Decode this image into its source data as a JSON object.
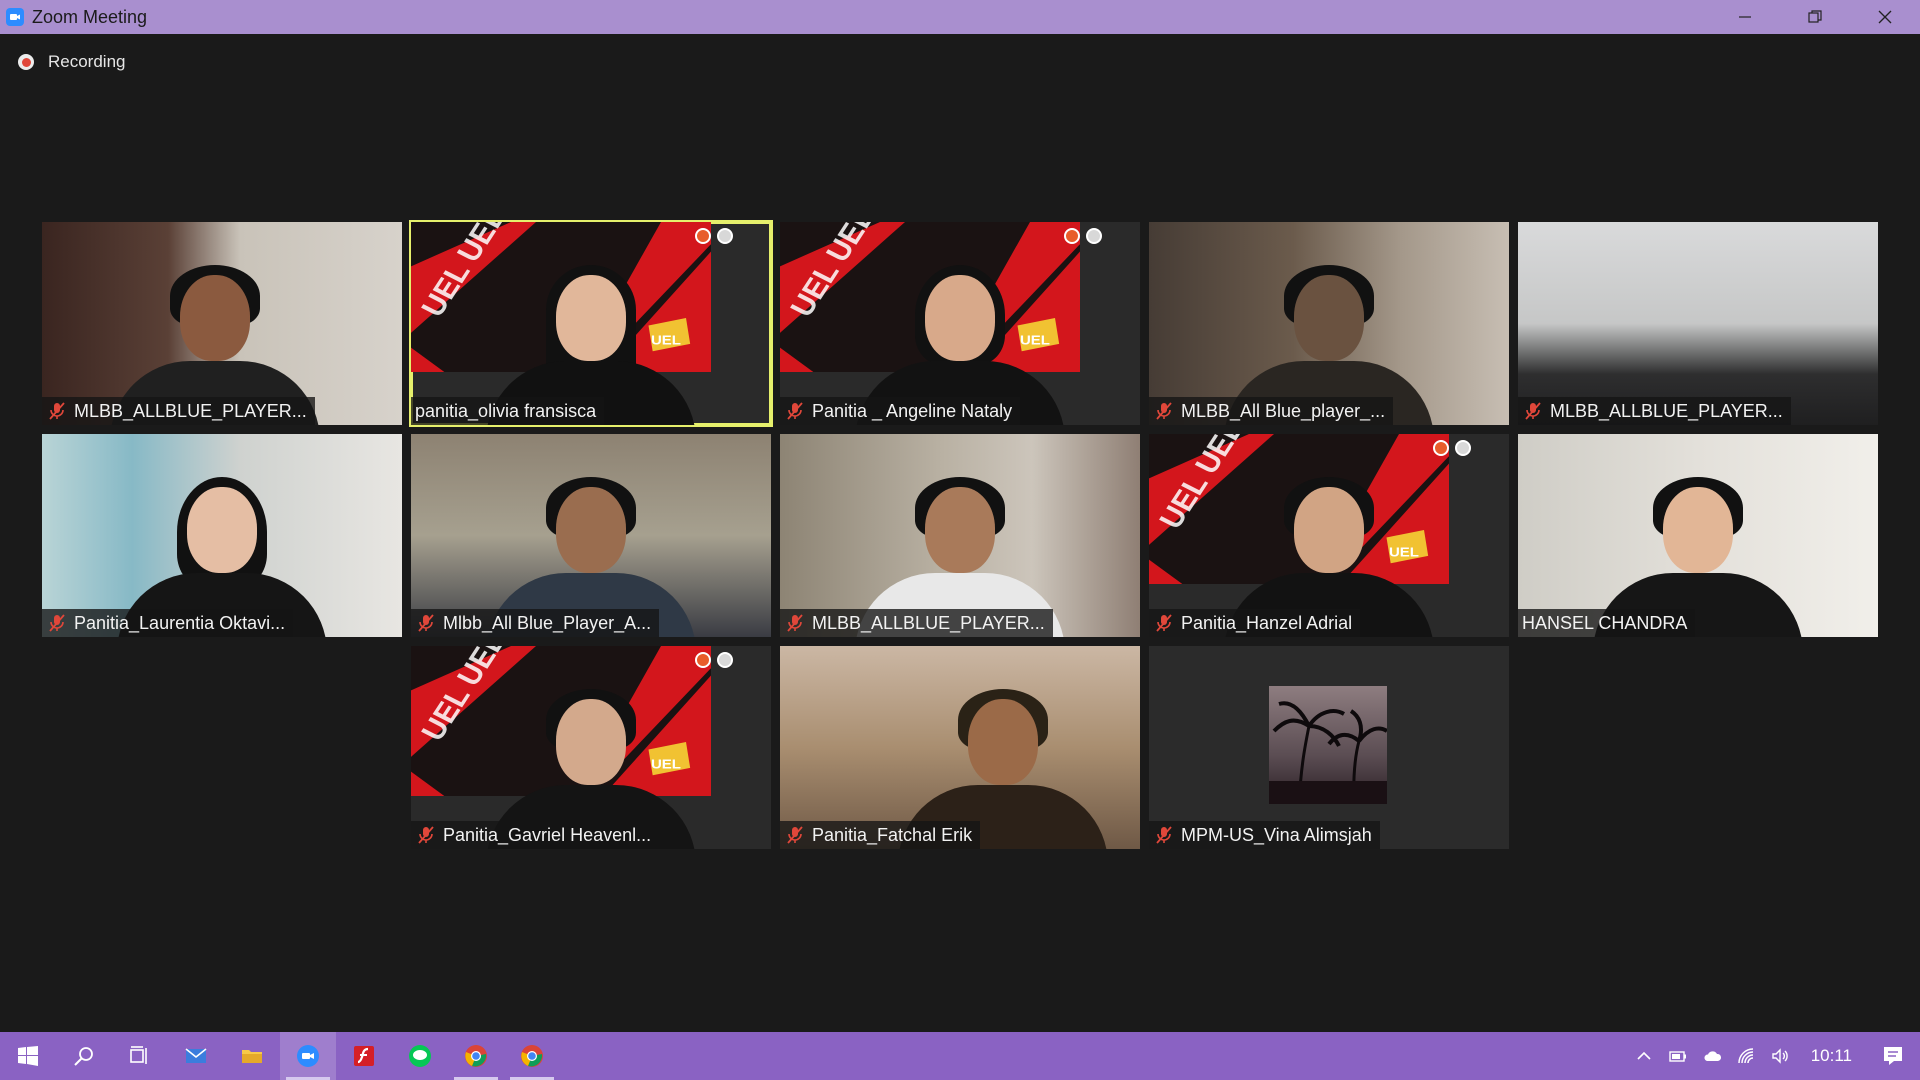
{
  "window": {
    "title": "Zoom Meeting"
  },
  "recording": {
    "label": "Recording"
  },
  "participants": [
    {
      "name": "MLBB_ALLBLUE_PLAYER..."
    },
    {
      "name": "panitia_olivia fransisca"
    },
    {
      "name": "Panitia _ Angeline Nataly"
    },
    {
      "name": "MLBB_All Blue_player_..."
    },
    {
      "name": "MLBB_ALLBLUE_PLAYER..."
    },
    {
      "name": "Panitia_Laurentia Oktavi..."
    },
    {
      "name": "Mlbb_All Blue_Player_A..."
    },
    {
      "name": "MLBB_ALLBLUE_PLAYER..."
    },
    {
      "name": "Panitia_Hanzel Adrial"
    },
    {
      "name": "HANSEL CHANDRA"
    },
    {
      "name": "Panitia_Gavriel Heavenl..."
    },
    {
      "name": "Panitia_Fatchal Erik"
    },
    {
      "name": "MPM-US_Vina Alimsjah"
    }
  ],
  "taskbar": {
    "clock": "10:11"
  },
  "colors": {
    "titlebar": "#a98fcf",
    "taskbar": "#8a62c3",
    "active_speaker": "#e6f06c"
  }
}
